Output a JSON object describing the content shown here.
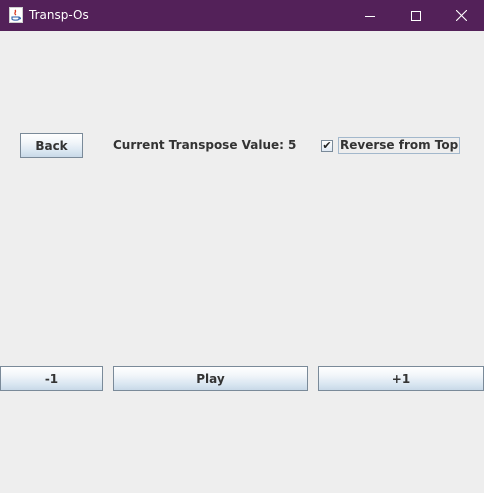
{
  "window": {
    "title": "Transp-Os",
    "controls": {
      "minimize": "minimize-icon",
      "maximize": "maximize-icon",
      "close": "close-icon"
    },
    "titlebar_color": "#532159"
  },
  "top_row": {
    "back_label": "Back",
    "transpose_label": "Current Transpose Value:",
    "transpose_value": "5",
    "reverse_checkbox": {
      "label": "Reverse from Top",
      "checked": true,
      "check_glyph": "✔"
    }
  },
  "bottom_row": {
    "decrement_label": "-1",
    "play_label": "Play",
    "increment_label": "+1"
  }
}
